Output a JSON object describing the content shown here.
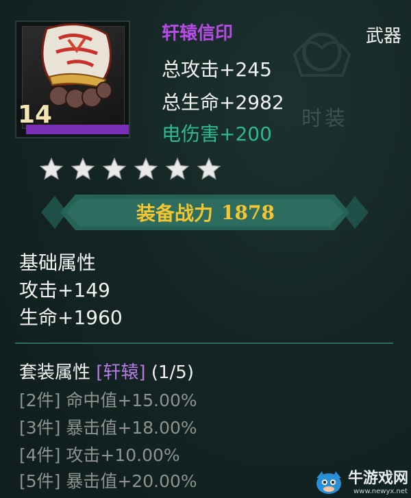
{
  "item": {
    "name": "轩辕信印",
    "type": "武器",
    "level": "14",
    "stats": [
      {
        "text": "总攻击+245",
        "color": "white"
      },
      {
        "text": "总生命+2982",
        "color": "white"
      },
      {
        "text": "电伤害+200",
        "color": "green"
      }
    ],
    "stars": 6,
    "icon": "fist-gauntlet-icon"
  },
  "watermark_tag": "时装",
  "power": {
    "label": "装备战力",
    "value": "1878"
  },
  "base": {
    "title": "基础属性",
    "lines": [
      "攻击+149",
      "生命+1960"
    ]
  },
  "set": {
    "title": "套装属性",
    "name": "[轩辕]",
    "progress": "(1/5)",
    "lines": [
      "[2件] 命中值+15.00%",
      "[3件] 暴击值+18.00%",
      "[4件] 攻击+10.00%",
      "[5件] 暴击值+20.00%"
    ]
  },
  "logo": {
    "name": "牛游戏网",
    "url": "www.newyx.net"
  },
  "colors": {
    "name": "#b84ce6",
    "green": "#2db994",
    "gold": "#f4c531",
    "set_name": "#b47be0",
    "rarity": "#7b2fb6"
  }
}
